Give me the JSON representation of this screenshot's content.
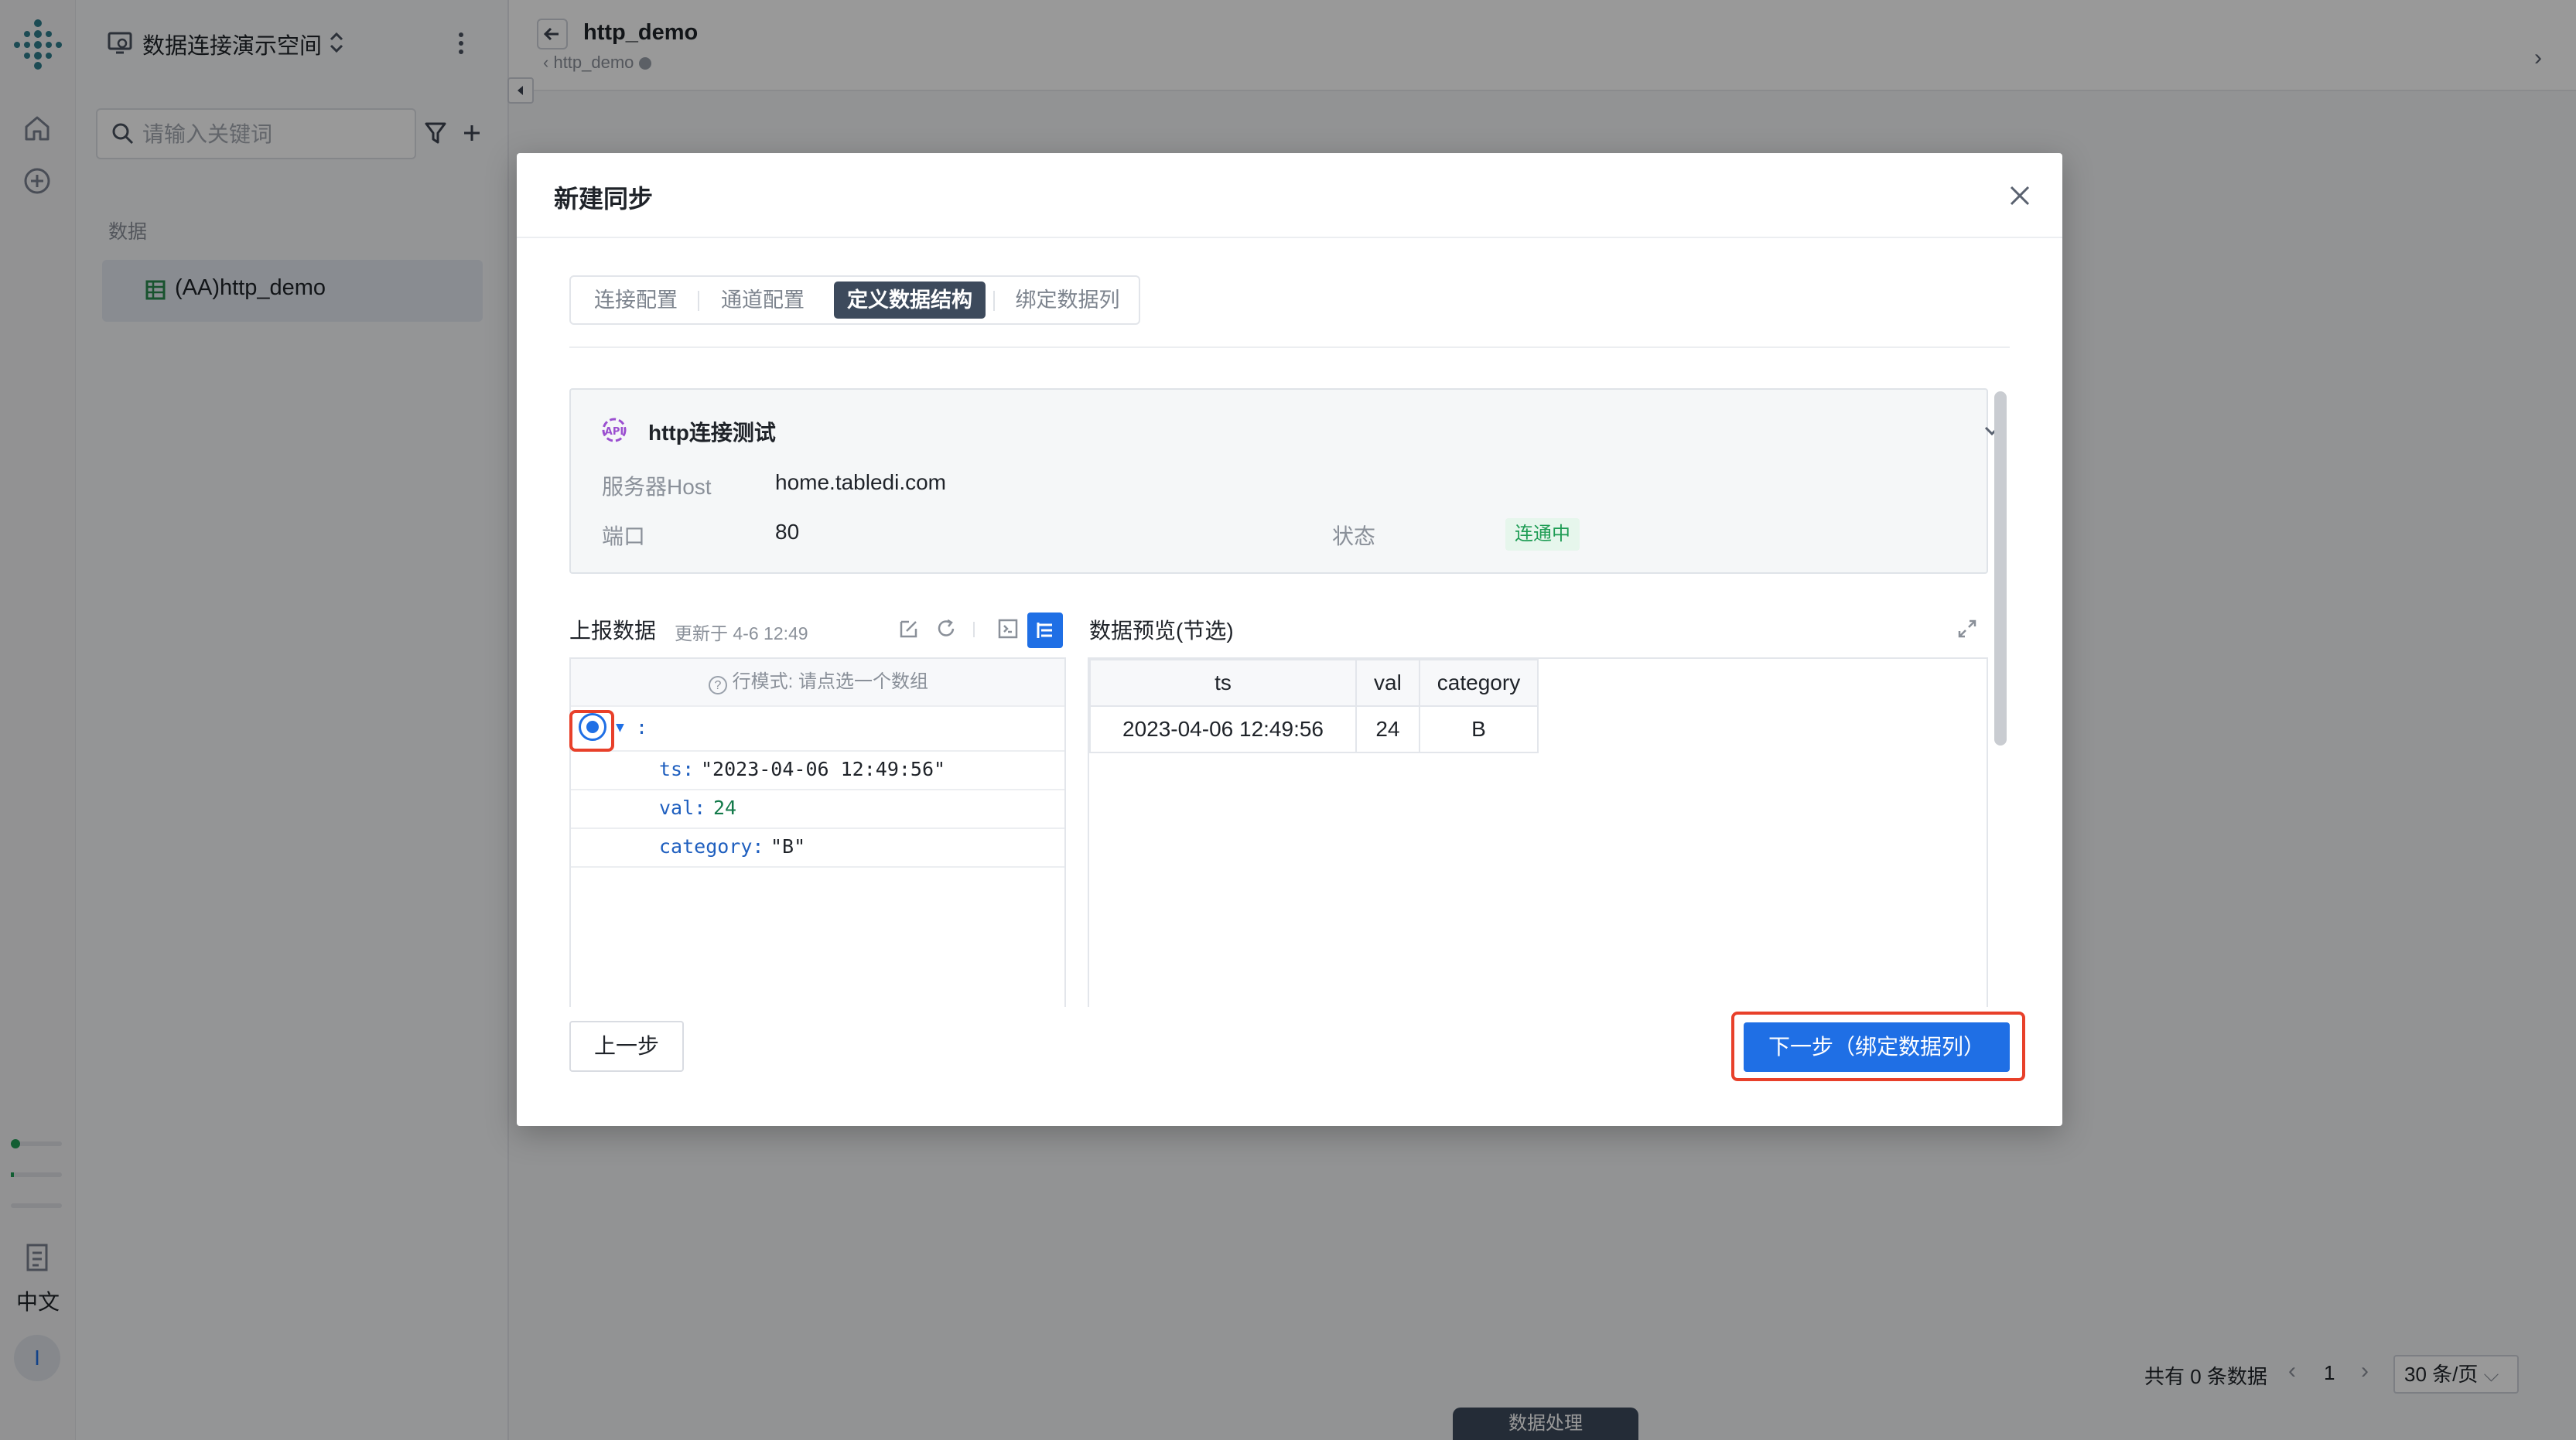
{
  "sidebar": {
    "workspace_name": "数据连接演示空间",
    "search_placeholder": "请输入关键词",
    "section_label": "数据",
    "items": [
      {
        "label": "(AA)http_demo"
      }
    ]
  },
  "rail": {
    "language": "中文",
    "user_initial": "I"
  },
  "header": {
    "title": "http_demo",
    "breadcrumb": "http_demo"
  },
  "modal": {
    "title": "新建同步",
    "tabs": [
      {
        "label": "连接配置",
        "active": false
      },
      {
        "label": "通道配置",
        "active": false
      },
      {
        "label": "定义数据结构",
        "active": true
      },
      {
        "label": "绑定数据列",
        "active": false
      }
    ],
    "connection": {
      "name": "http连接测试",
      "host_label": "服务器Host",
      "host_value": "home.tabledi.com",
      "port_label": "端口",
      "port_value": "80",
      "status_label": "状态",
      "status_value": "连通中"
    },
    "report": {
      "title": "上报数据",
      "updated": "更新于 4-6 12:49",
      "hint": "行模式: 请点选一个数组",
      "root_colon": ":",
      "fields": [
        {
          "key": "ts:",
          "value": "\"2023-04-06 12:49:56\"",
          "kind": "string"
        },
        {
          "key": "val:",
          "value": "24",
          "kind": "number"
        },
        {
          "key": "category:",
          "value": "\"B\"",
          "kind": "string"
        }
      ]
    },
    "preview": {
      "title": "数据预览(节选)",
      "columns": [
        "ts",
        "val",
        "category"
      ],
      "rows": [
        [
          "2023-04-06 12:49:56",
          "24",
          "B"
        ]
      ]
    },
    "prev_button": "上一步",
    "next_button": "下一步（绑定数据列）"
  },
  "footer": {
    "total": "共有 0 条数据",
    "page": "1",
    "page_size": "30 条/页",
    "floating_tab": "数据处理"
  },
  "colors": {
    "primary": "#1f6fe5",
    "active_tab": "#3d4a5c",
    "highlight": "#e8402a",
    "status_green": "#1f9d55"
  }
}
